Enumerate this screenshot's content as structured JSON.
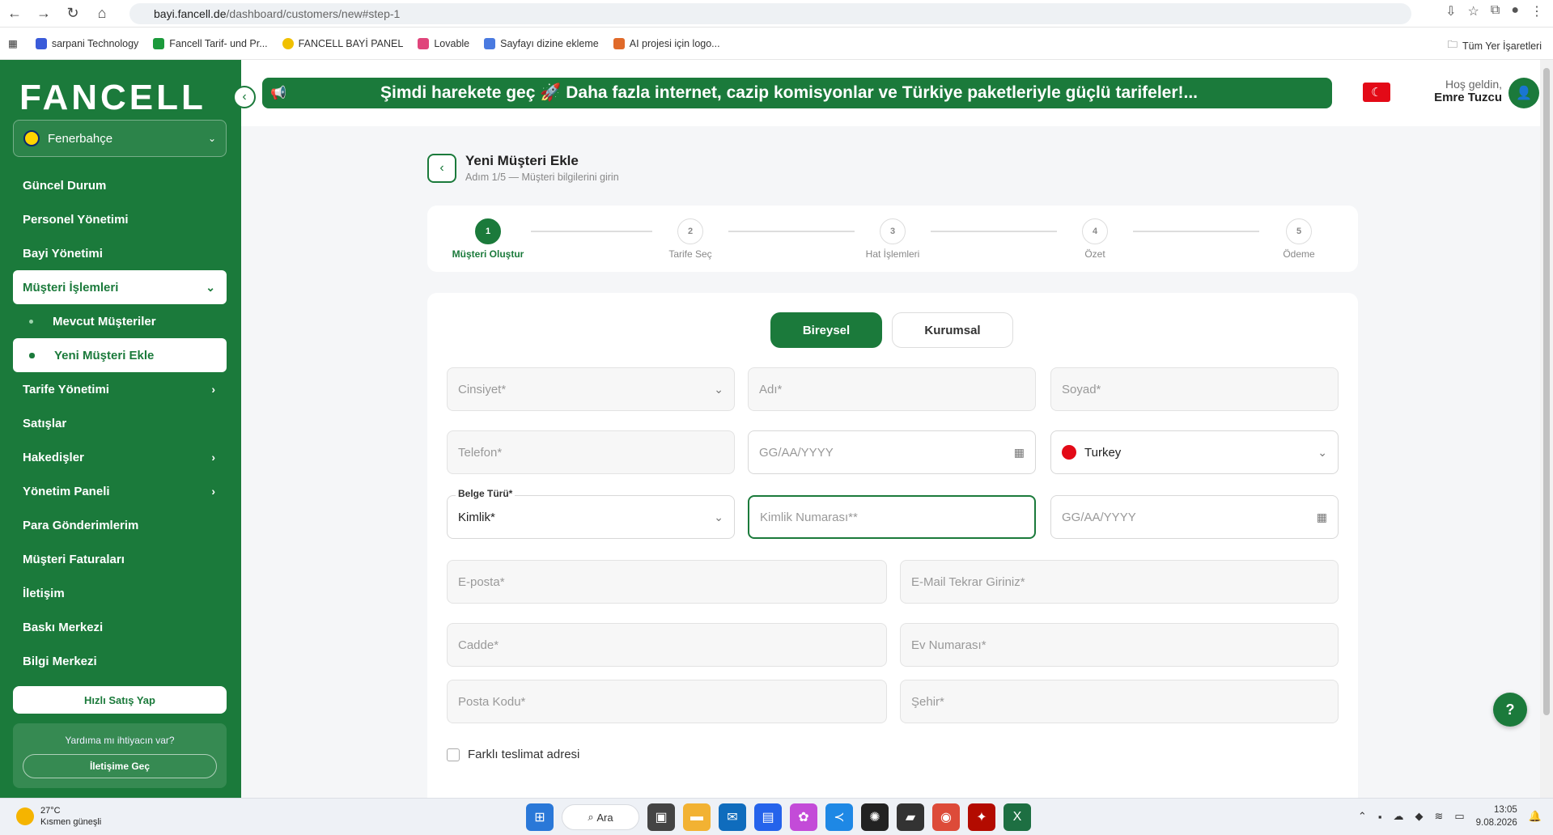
{
  "browser": {
    "url_host": "bayi.fancell.de",
    "url_path": "/dashboard/customers/new#step-1",
    "bookmarks": [
      "sarpani Technology",
      "Fancell Tarif- und Pr...",
      "FANCELL BAYİ PANEL",
      "Lovable",
      "Sayfayı dizine ekleme",
      "AI projesi için logo..."
    ],
    "all_bookmarks": "Tüm Yer İşaretleri"
  },
  "sidebar": {
    "logo": "FANCELL",
    "team": "Fenerbahçe",
    "items": [
      {
        "label": "Güncel Durum"
      },
      {
        "label": "Personel Yönetimi"
      },
      {
        "label": "Bayi Yönetimi"
      },
      {
        "label": "Müşteri İşlemleri"
      },
      {
        "label": "Mevcut Müşteriler"
      },
      {
        "label": "Yeni Müşteri Ekle"
      },
      {
        "label": "Tarife Yönetimi"
      },
      {
        "label": "Satışlar"
      },
      {
        "label": "Hakedişler"
      },
      {
        "label": "Yönetim Paneli"
      },
      {
        "label": "Para Gönderimlerim"
      },
      {
        "label": "Müşteri Faturaları"
      },
      {
        "label": "İletişim"
      },
      {
        "label": "Baskı Merkezi"
      },
      {
        "label": "Bilgi Merkezi"
      }
    ],
    "quick_sale": "Hızlı Satış Yap",
    "help_text": "Yardıma mı ihtiyacın var?",
    "help_button": "İletişime Geç"
  },
  "header": {
    "banner": "Şimdi harekete geç 🚀 Daha fazla internet, cazip komisyonlar ve Türkiye paketleriyle güçlü tarifeler!...",
    "greeting": "Hoş geldin,",
    "user_name": "Emre Tuzcu"
  },
  "page": {
    "title": "Yeni Müşteri Ekle",
    "subtitle": "Adım 1/5 — Müşteri bilgilerini girin"
  },
  "steps": [
    {
      "num": "1",
      "label": "Müşteri Oluştur"
    },
    {
      "num": "2",
      "label": "Tarife Seç"
    },
    {
      "num": "3",
      "label": "Hat İşlemleri"
    },
    {
      "num": "4",
      "label": "Özet"
    },
    {
      "num": "5",
      "label": "Ödeme"
    }
  ],
  "form": {
    "type_individual": "Bireysel",
    "type_corporate": "Kurumsal",
    "gender": "Cinsiyet*",
    "first_name": "Adı*",
    "last_name": "Soyad*",
    "phone": "Telefon*",
    "birth_date": "GG/AA/YYYY",
    "country": "Turkey",
    "doc_type_label": "Belge Türü*",
    "doc_type": "Kimlik*",
    "id_number": "Kimlik Numarası**",
    "doc_date": "GG/AA/YYYY",
    "email": "E-posta*",
    "email_repeat": "E-Mail Tekrar Giriniz*",
    "street": "Cadde*",
    "house_no": "Ev Numarası*",
    "postal_code": "Posta Kodu*",
    "city": "Şehir*",
    "different_delivery": "Farklı teslimat adresi"
  },
  "taskbar": {
    "temp": "27°C",
    "weather": "Kısmen güneşli",
    "search": "Ara",
    "time": "13:05",
    "date": "9.08.2026"
  },
  "colors": {
    "brand": "#1b7a3b",
    "flag": "#e30a17"
  }
}
